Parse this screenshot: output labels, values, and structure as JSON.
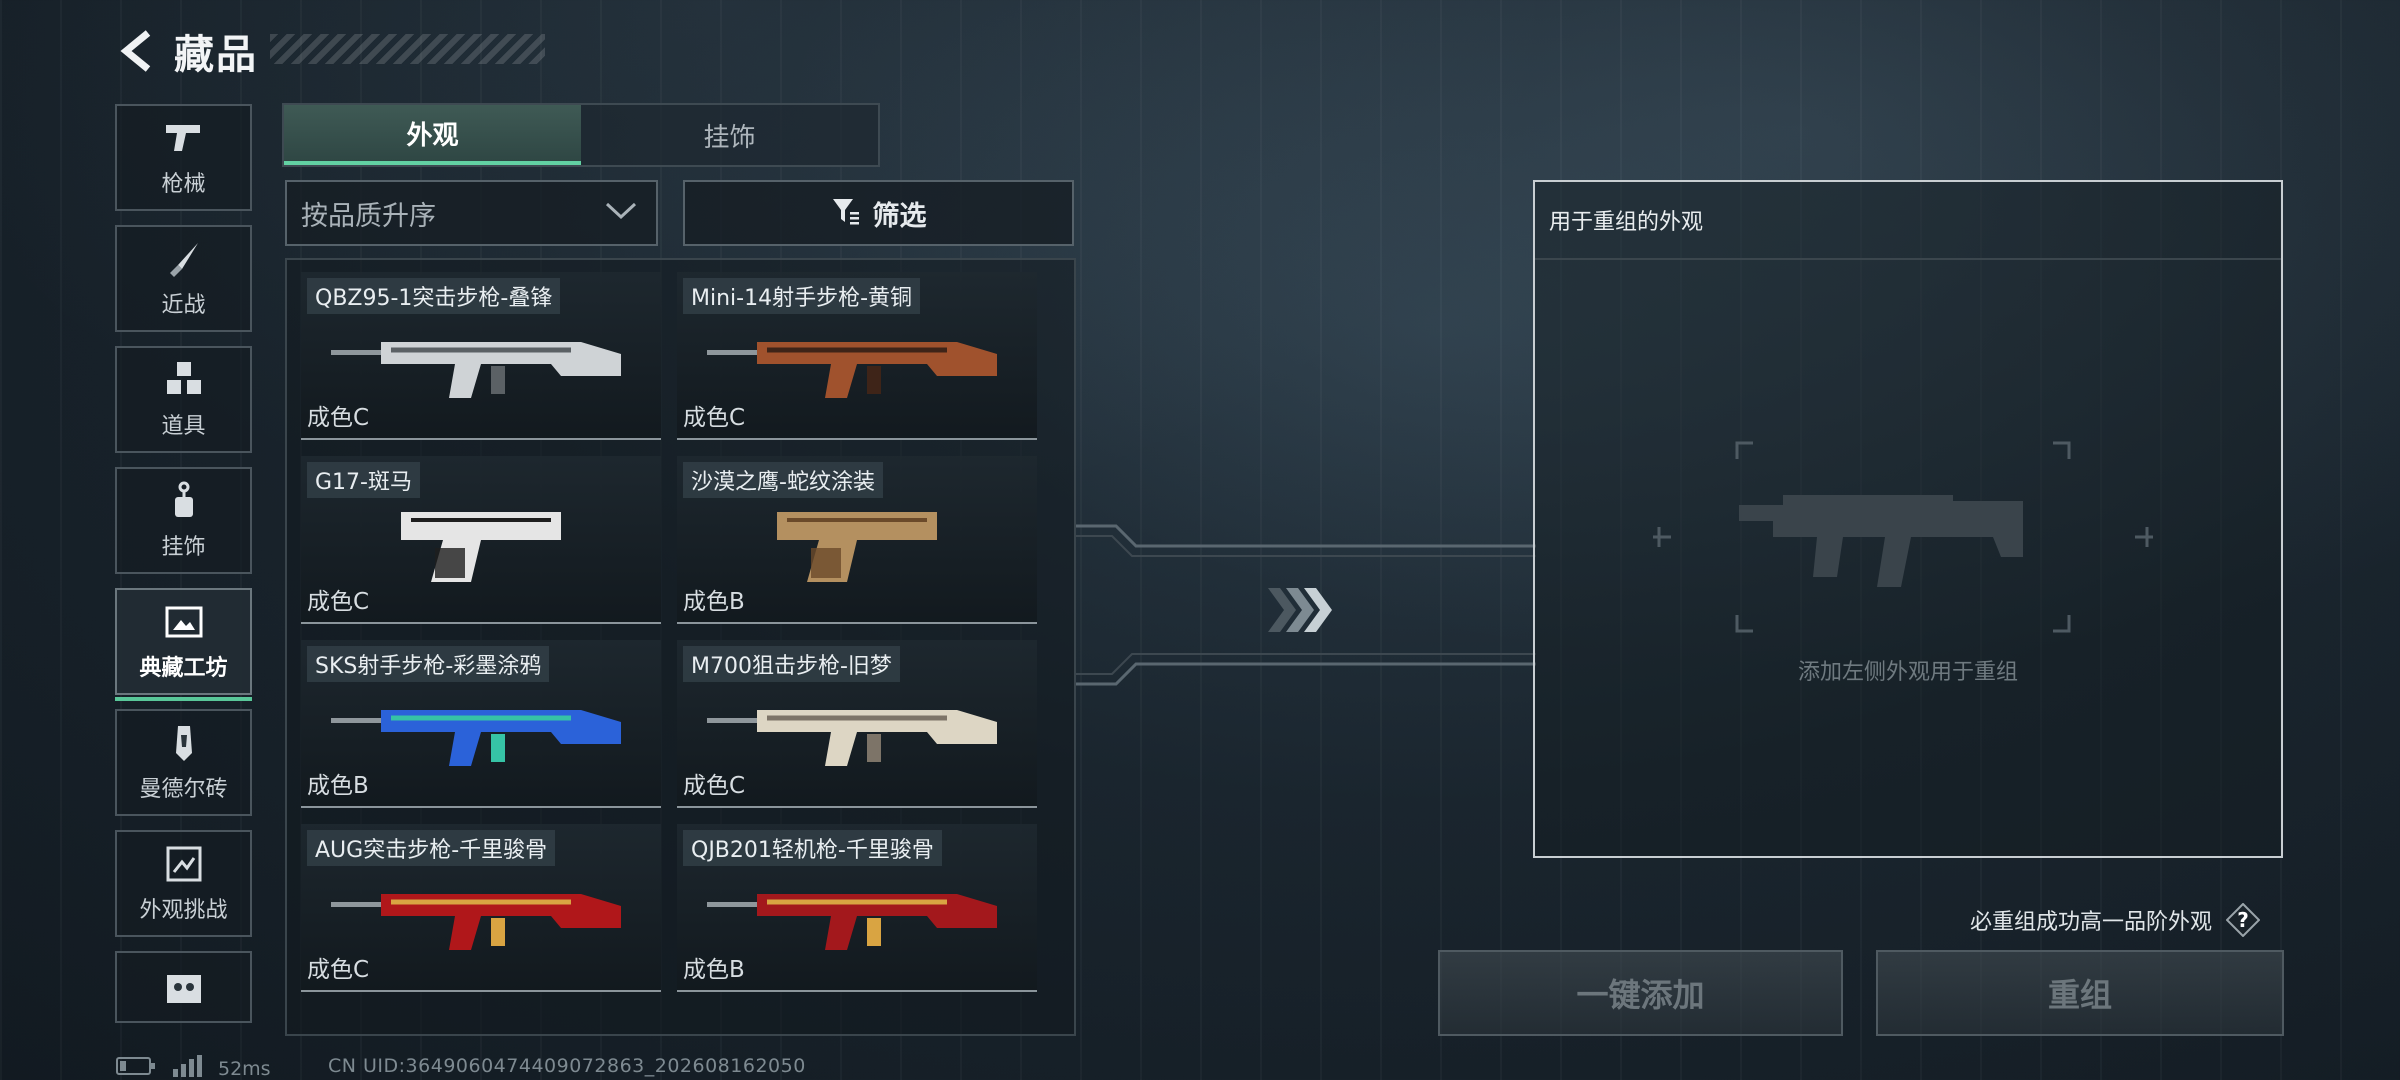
{
  "header": {
    "title": "藏品"
  },
  "sidebar": {
    "items": [
      {
        "label": "枪械",
        "icon": "pistol-icon",
        "active": false
      },
      {
        "label": "近战",
        "icon": "knife-icon",
        "active": false
      },
      {
        "label": "道具",
        "icon": "cubes-icon",
        "active": false
      },
      {
        "label": "挂饰",
        "icon": "charm-icon",
        "active": false
      },
      {
        "label": "典藏工坊",
        "icon": "workshop-icon",
        "active": true
      },
      {
        "label": "曼德尔砖",
        "icon": "brick-icon",
        "active": false
      },
      {
        "label": "外观挑战",
        "icon": "challenge-icon",
        "active": false
      },
      {
        "label": "",
        "icon": "skull-icon",
        "active": false
      }
    ]
  },
  "tabs": [
    {
      "label": "外观",
      "active": true
    },
    {
      "label": "挂饰",
      "active": false
    }
  ],
  "sort": {
    "label": "按品质升序"
  },
  "filter": {
    "label": "筛选"
  },
  "items": [
    {
      "name": "QBZ95-1突击步枪-叠锋",
      "grade": "成色C",
      "colors": [
        "#cfd3d6",
        "#5b6165"
      ]
    },
    {
      "name": "Mini-14射手步枪-黄铜",
      "grade": "成色C",
      "colors": [
        "#a0522d",
        "#3e2418"
      ]
    },
    {
      "name": "G17-斑马",
      "grade": "成色C",
      "colors": [
        "#e5e5e5",
        "#1e1e1e"
      ]
    },
    {
      "name": "沙漠之鹰-蛇纹涂装",
      "grade": "成色B",
      "colors": [
        "#b49060",
        "#6b4a2a"
      ]
    },
    {
      "name": "SKS射手步枪-彩墨涂鸦",
      "grade": "成色B",
      "colors": [
        "#2b62d9",
        "#36c3a6"
      ]
    },
    {
      "name": "M700狙击步枪-旧梦",
      "grade": "成色C",
      "colors": [
        "#ddd6c4",
        "#7d7468"
      ]
    },
    {
      "name": "AUG突击步枪-千里骏骨",
      "grade": "成色C",
      "colors": [
        "#b0171a",
        "#d9a442"
      ]
    },
    {
      "name": "QJB201轻机枪-千里骏骨",
      "grade": "成色B",
      "colors": [
        "#a3181c",
        "#d9a442"
      ]
    }
  ],
  "recompose": {
    "panel_title": "用于重组的外观",
    "hint": "添加左侧外观用于重组",
    "guarantee": "必重组成功高一品阶外观",
    "add_all_label": "一键添加",
    "recompose_label": "重组"
  },
  "status": {
    "ping": "52ms",
    "uid": "CN UID:36490604744090728​63_202608162050"
  }
}
